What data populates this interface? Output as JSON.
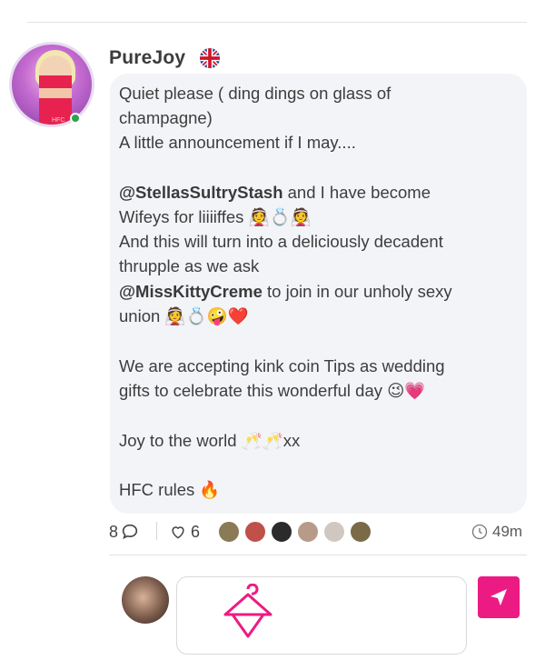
{
  "post": {
    "username": "PureJoy",
    "country_flag": "uk-flag",
    "avatar_watermark": "HFC",
    "online": true,
    "lines": [
      {
        "text": "Quiet please ( ding dings on glass of"
      },
      {
        "text": "champagne)"
      },
      {
        "text": "A little announcement if I may...."
      },
      {
        "text": ""
      },
      {
        "mention": "@StellasSultryStash",
        "text": " and I have become"
      },
      {
        "text": "Wifeys for liiiiffes 👰💍👰"
      },
      {
        "text": "And this will turn into a deliciously decadent"
      },
      {
        "text": "thrupple as we ask"
      },
      {
        "mention": "@MissKittyCreme",
        "text": " to join in our unholy sexy"
      },
      {
        "text": "union 👰💍🤪❤️"
      },
      {
        "text": ""
      },
      {
        "text": "We are accepting kink coin Tips as wedding"
      },
      {
        "text": "gifts to celebrate this wonderful day 😉💗"
      },
      {
        "text": ""
      },
      {
        "text": "Joy to the world 🥂🥂xx"
      },
      {
        "text": ""
      },
      {
        "text": "HFC rules 🔥"
      }
    ]
  },
  "footer": {
    "comment_count": "8",
    "like_count": "6",
    "time_ago": "49m"
  },
  "likers": [
    {
      "name": "liker-1",
      "color": "#8a7a55"
    },
    {
      "name": "liker-2",
      "color": "#c0504a"
    },
    {
      "name": "liker-3",
      "color": "#2b2b2b"
    },
    {
      "name": "liker-4",
      "color": "#b89a8a"
    },
    {
      "name": "liker-5",
      "color": "#d0c8c0"
    },
    {
      "name": "liker-6",
      "color": "#7a6a48"
    }
  ],
  "reply": {
    "placeholder": ""
  },
  "colors": {
    "accent": "#ec1b83",
    "bubble": "#f3f4f8",
    "online": "#2fa34a"
  }
}
